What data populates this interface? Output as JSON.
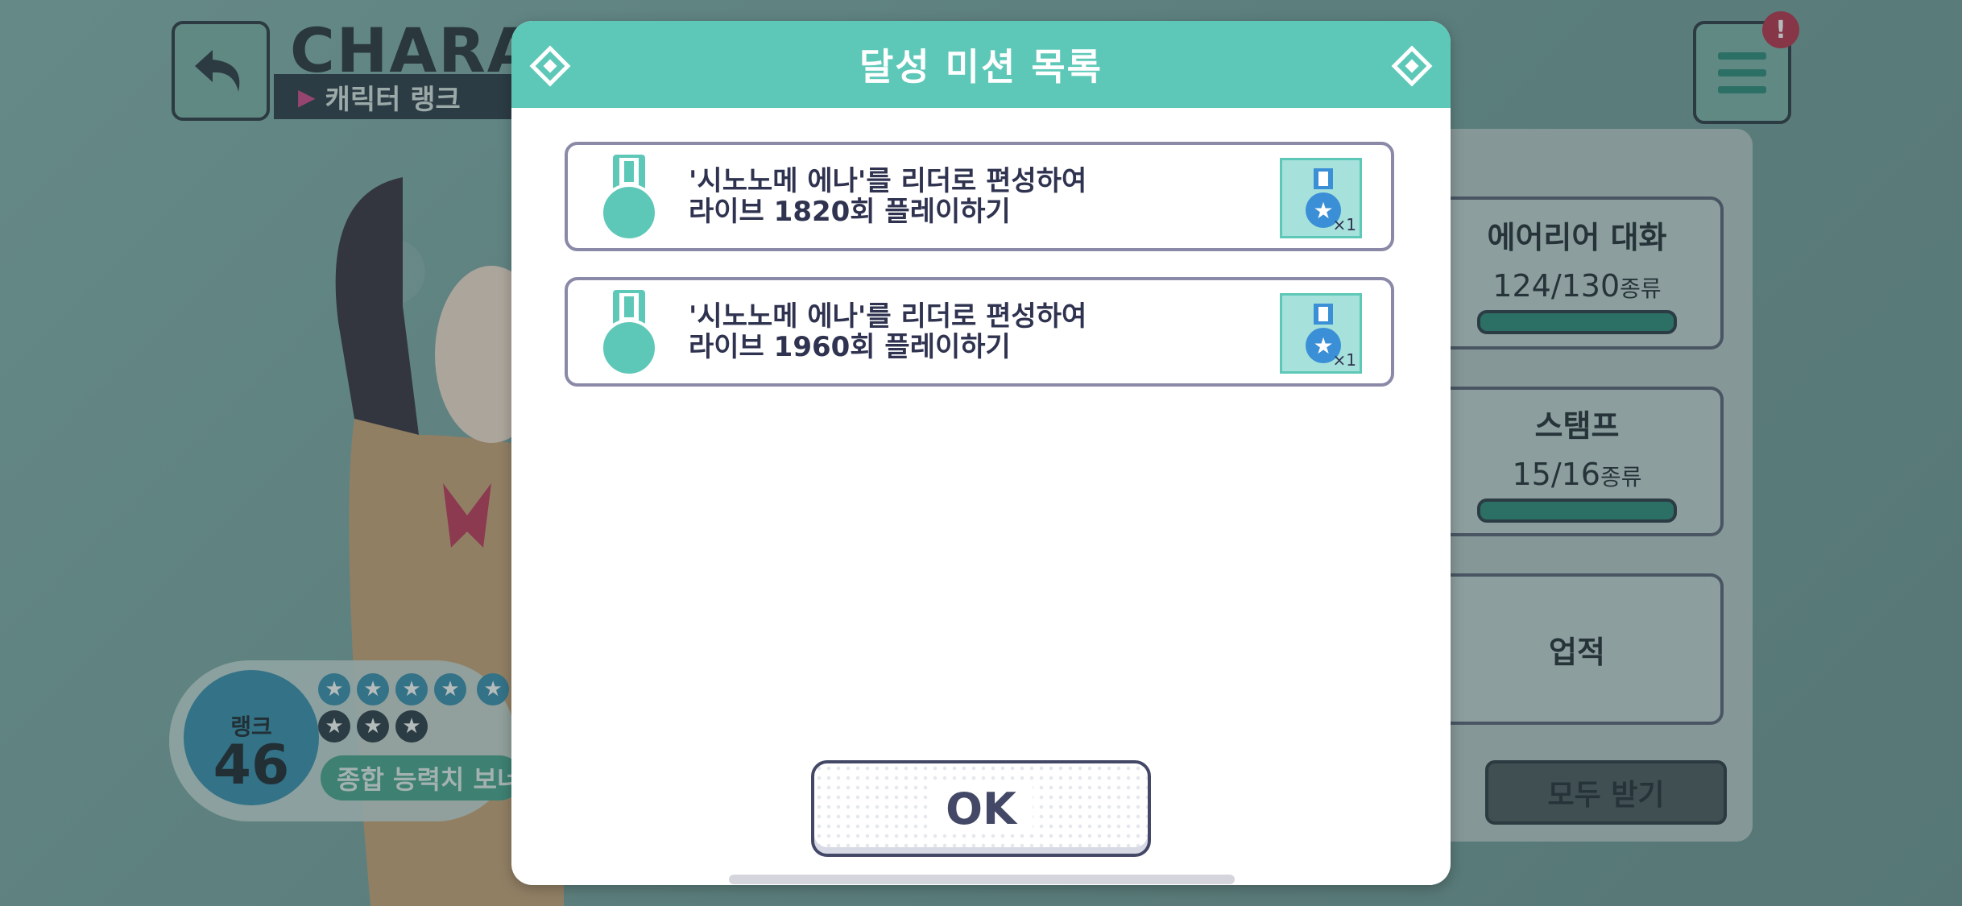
{
  "header": {
    "title": "CHARAC",
    "subtitle": "캐릭터 랭크"
  },
  "rank": {
    "label": "랭크",
    "value": "46",
    "bonus_text": "종합 능력치 보너"
  },
  "right_panel": {
    "cards": [
      {
        "title": "에어리어 대화",
        "count": "124/130",
        "unit": "종류",
        "progress": 0.95
      },
      {
        "title": "스탬프",
        "count": "15/16",
        "unit": "종류",
        "progress": 0.94
      },
      {
        "title": "업적"
      }
    ],
    "claim_all_label": "모두 받기"
  },
  "modal": {
    "title": "달성 미션 목록",
    "missions": [
      {
        "line1": "'시노노메 에나'를 리더로 편성하여",
        "line2": "라이브 1820회 플레이하기",
        "reward_qty": "×1",
        "reward_icon": "medal-icon"
      },
      {
        "line1": "'시노노메 에나'를 리더로 편성하여",
        "line2": "라이브 1960회 플레이하기",
        "reward_qty": "×1",
        "reward_icon": "medal-icon"
      }
    ],
    "ok_label": "OK"
  },
  "colors": {
    "accent": "#5ec8b8",
    "text_dark": "#2f3350",
    "alert": "#b8344c"
  },
  "icons": {
    "back": "back-arrow-icon",
    "menu": "hamburger-menu-icon",
    "alert": "alert-badge-icon",
    "mission": "medal-icon"
  },
  "alert_badge": "!"
}
